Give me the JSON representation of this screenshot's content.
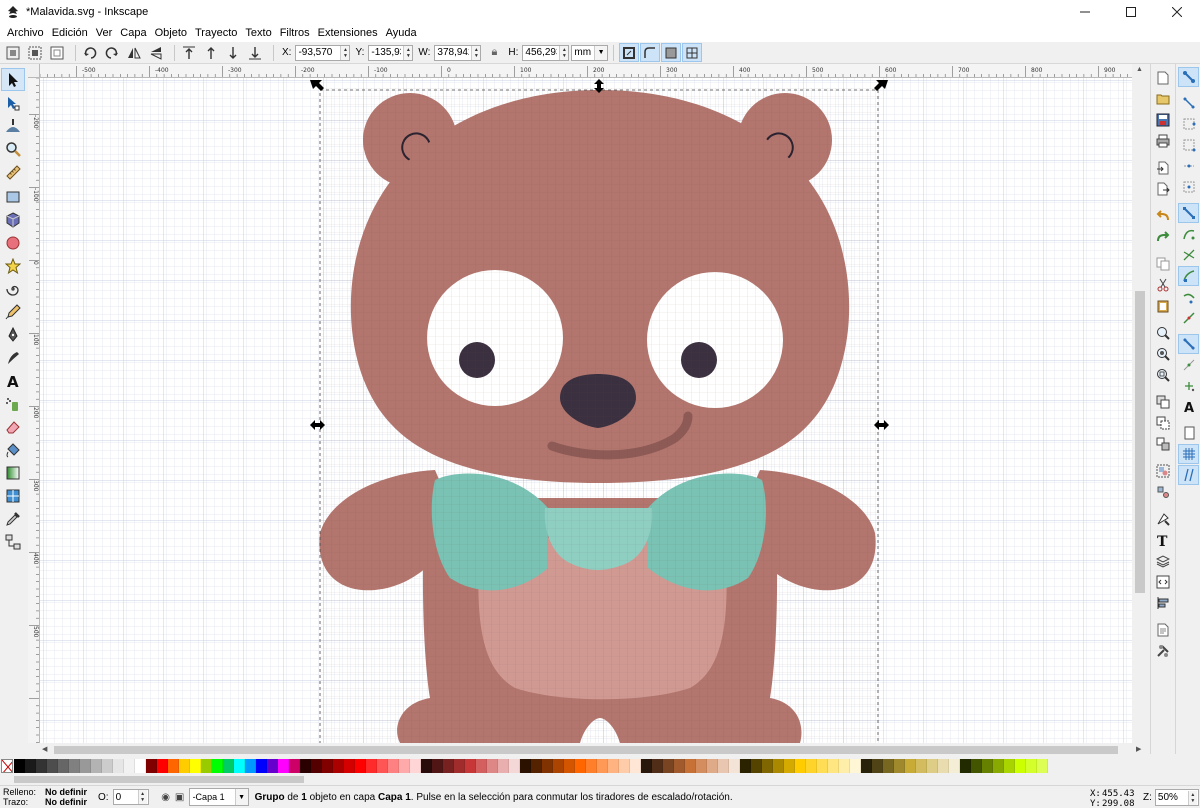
{
  "window": {
    "title": "*Malavida.svg - Inkscape",
    "controls": [
      "minimize",
      "maximize",
      "close"
    ]
  },
  "menu": [
    {
      "label": "Archivo"
    },
    {
      "label": "Edición"
    },
    {
      "label": "Ver"
    },
    {
      "label": "Capa"
    },
    {
      "label": "Objeto"
    },
    {
      "label": "Trayecto"
    },
    {
      "label": "Texto"
    },
    {
      "label": "Filtros"
    },
    {
      "label": "Extensiones"
    },
    {
      "label": "Ayuda"
    }
  ],
  "tool_controls": {
    "x_label": "X:",
    "x_value": "-93,570",
    "y_label": "Y:",
    "y_value": "-135,93",
    "w_label": "W:",
    "w_value": "378,942",
    "h_label": "H:",
    "h_value": "456,293",
    "unit": "mm"
  },
  "ruler": {
    "top_labels": [
      "-500",
      "-400",
      "-300",
      "-200",
      "-100",
      "0",
      "100",
      "200",
      "300",
      "400",
      "500",
      "600",
      "700",
      "800",
      "900"
    ],
    "left_labels": [
      "-200",
      "-100",
      "0",
      "100",
      "200",
      "300",
      "400",
      "500"
    ]
  },
  "status": {
    "fill_label": "Relleno:",
    "fill_value": "No definir",
    "stroke_label": "Trazo:",
    "stroke_value": "No definir",
    "opacity_label": "O:",
    "opacity_value": "0",
    "layer": "-Capa 1",
    "message_b1": "Grupo",
    "message_t1": " de ",
    "message_b2": "1",
    "message_t2": " objeto en capa ",
    "message_b3": "Capa 1",
    "message_t3": ". Pulse en la selección para conmutar los tiradores de escalado/rotación.",
    "cursor_x_label": "X:",
    "cursor_x": "455.43",
    "cursor_y_label": "Y:",
    "cursor_y": "299.08",
    "zoom_label": "Z:",
    "zoom_value": "50%"
  },
  "colors": {
    "bear_body": "#b2766e",
    "bear_belly": "#d09a93",
    "bow": "#79c2b4",
    "bow_center": "#8fcfc2",
    "eye_pupil": "#3b3040",
    "mouth": "#8d5a55",
    "selection_handle": "#000000",
    "grid": "#d6dcea"
  },
  "palette": [
    "#000000",
    "#1a1a1a",
    "#333333",
    "#4d4d4d",
    "#666666",
    "#808080",
    "#999999",
    "#b3b3b3",
    "#cccccc",
    "#e6e6e6",
    "#f2f2f2",
    "#ffffff",
    "#800000",
    "#ff0000",
    "#ff6600",
    "#ffcc00",
    "#ffff00",
    "#99cc00",
    "#00ff00",
    "#00cc66",
    "#00ffff",
    "#0099ff",
    "#0000ff",
    "#6600cc",
    "#ff00ff",
    "#cc0066",
    "#2b0000",
    "#550000",
    "#800000",
    "#aa0000",
    "#d40000",
    "#ff0000",
    "#ff2a2a",
    "#ff5555",
    "#ff8080",
    "#ffaaaa",
    "#ffd5d5",
    "#280b0b",
    "#501616",
    "#782121",
    "#a02c2c",
    "#c83737",
    "#d35f5f",
    "#de8787",
    "#e9afaf",
    "#f4d7d7",
    "#2b1100",
    "#552200",
    "#803300",
    "#aa4400",
    "#d45500",
    "#ff6600",
    "#ff7f2a",
    "#ff9955",
    "#ffb380",
    "#ffccaa",
    "#ffe6d5",
    "#28170b",
    "#502d16",
    "#784421",
    "#a05a2c",
    "#c87137",
    "#d38d5f",
    "#deaa87",
    "#e9c6af",
    "#f4e3d7",
    "#2b2200",
    "#554400",
    "#806600",
    "#aa8800",
    "#d4aa00",
    "#ffcc00",
    "#ffd42a",
    "#ffdd55",
    "#ffe680",
    "#ffeeaa",
    "#fff6d5",
    "#28220b",
    "#504416",
    "#786721",
    "#a0892c",
    "#c8ab37",
    "#d3bc5f",
    "#decd87",
    "#e9ddaf",
    "#f4eed7",
    "#222b00",
    "#445500",
    "#668000",
    "#88aa00",
    "#aad400",
    "#ccff00",
    "#d4ff2a",
    "#ddff55"
  ]
}
